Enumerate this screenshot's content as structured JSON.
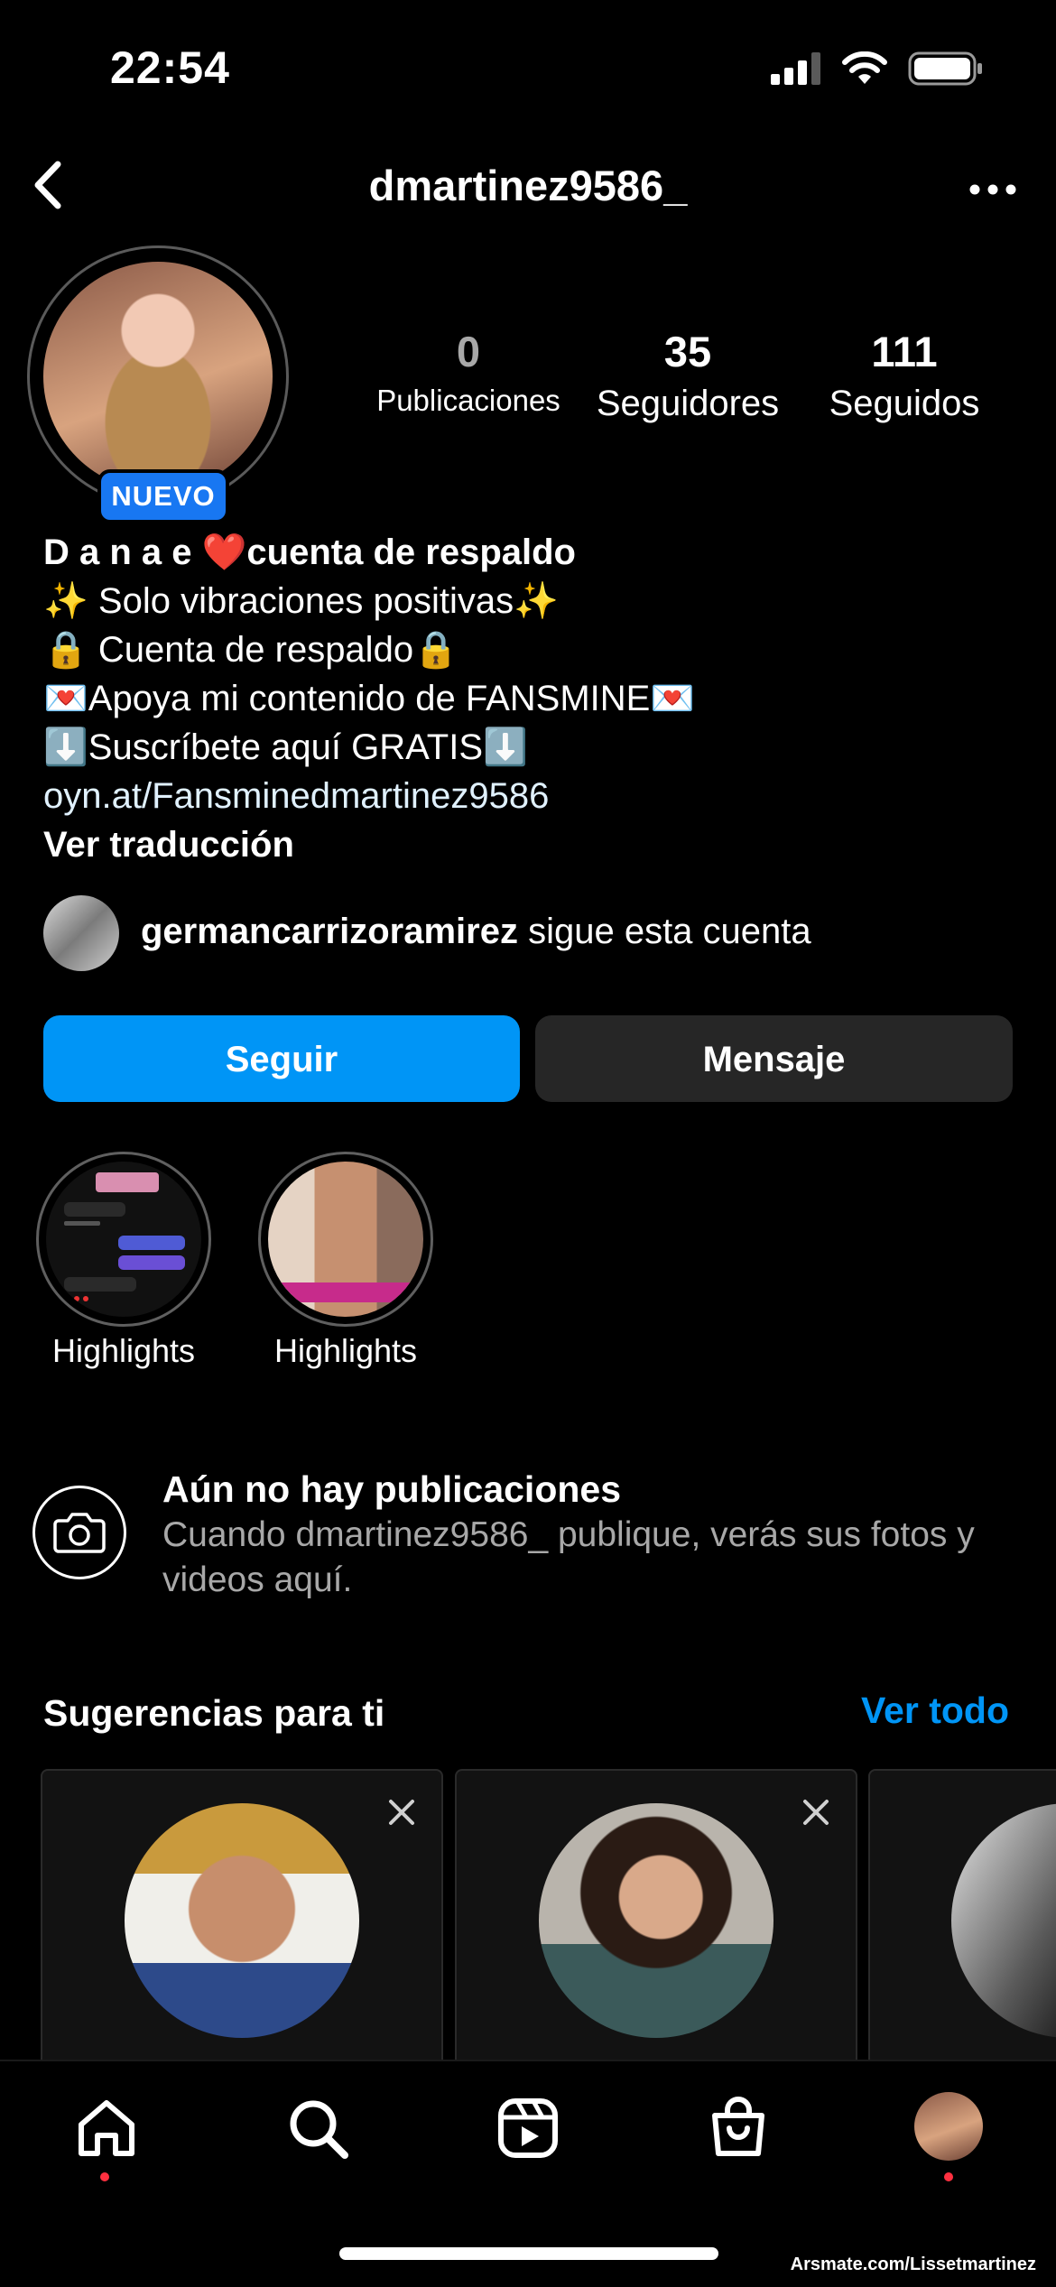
{
  "status_bar": {
    "time": "22:54"
  },
  "header": {
    "username": "dmartinez9586_"
  },
  "profile": {
    "badge": "NUEVO",
    "stats": [
      {
        "value": "0",
        "label": "Publicaciones"
      },
      {
        "value": "35",
        "label": "Seguidores"
      },
      {
        "value": "111",
        "label": "Seguidos"
      }
    ],
    "bio": {
      "name": "D a n a e ❤️cuenta de respaldo",
      "lines": [
        "✨ Solo vibraciones positivas✨",
        "🔒 Cuenta de respaldo🔒",
        "💌Apoya mi contenido de FANSMINE💌",
        "⬇️Suscríbete aquí GRATIS⬇️"
      ],
      "link": "oyn.at/Fansminedmartinez9586",
      "translate": "Ver traducción"
    },
    "followed_by": {
      "user": "germancarrizoramirez",
      "suffix": " sigue esta cuenta"
    }
  },
  "actions": {
    "follow": "Seguir",
    "message": "Mensaje"
  },
  "highlights": [
    {
      "label": "Highlights"
    },
    {
      "label": "Highlights"
    }
  ],
  "empty_state": {
    "title": "Aún no hay publicaciones",
    "description": "Cuando dmartinez9586_ publique, verás sus fotos y videos aquí."
  },
  "suggestions": {
    "title": "Sugerencias para ti",
    "see_all": "Ver todo"
  },
  "watermark": "Arsmate.com/Lissetmartinez",
  "colors": {
    "accent": "#0095f6",
    "badge": "#1877f2",
    "notification": "#ff3040",
    "secondary_button": "#262626"
  },
  "icons": [
    "back-icon",
    "more-icon",
    "camera-icon",
    "close-icon",
    "home-icon",
    "search-icon",
    "reels-icon",
    "shop-icon",
    "profile-icon"
  ]
}
